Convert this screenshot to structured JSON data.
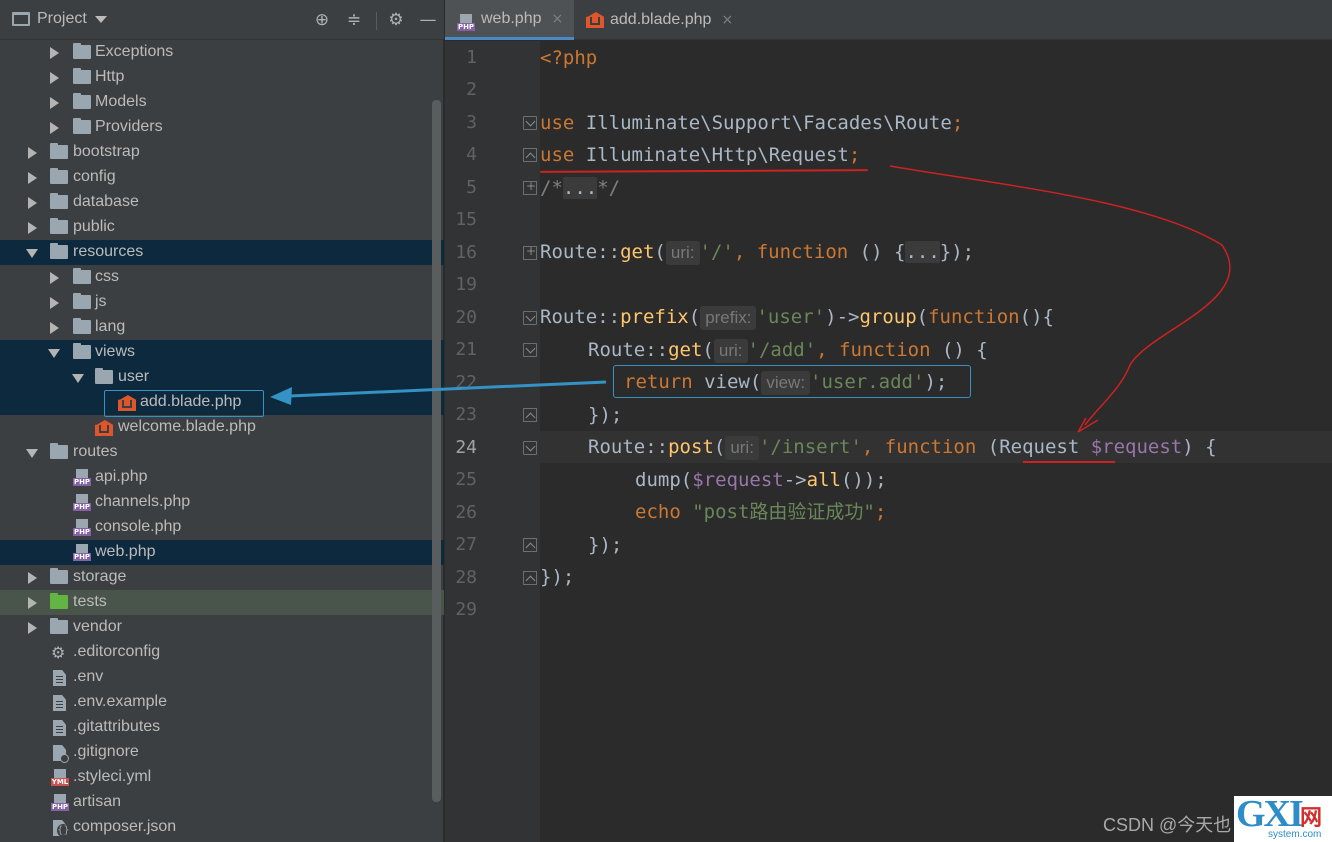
{
  "project_panel": {
    "title": "Project",
    "tree": [
      {
        "label": "Exceptions"
      },
      {
        "label": "Http"
      },
      {
        "label": "Models"
      },
      {
        "label": "Providers"
      },
      {
        "label": "bootstrap"
      },
      {
        "label": "config"
      },
      {
        "label": "database"
      },
      {
        "label": "public"
      },
      {
        "label": "resources"
      },
      {
        "label": "css"
      },
      {
        "label": "js"
      },
      {
        "label": "lang"
      },
      {
        "label": "views"
      },
      {
        "label": "user"
      },
      {
        "label": "add.blade.php"
      },
      {
        "label": "welcome.blade.php"
      },
      {
        "label": "routes"
      },
      {
        "label": "api.php"
      },
      {
        "label": "channels.php"
      },
      {
        "label": "console.php"
      },
      {
        "label": "web.php"
      },
      {
        "label": "storage"
      },
      {
        "label": "tests"
      },
      {
        "label": "vendor"
      },
      {
        "label": ".editorconfig"
      },
      {
        "label": ".env"
      },
      {
        "label": ".env.example"
      },
      {
        "label": ".gitattributes"
      },
      {
        "label": ".gitignore"
      },
      {
        "label": ".styleci.yml"
      },
      {
        "label": "artisan"
      },
      {
        "label": "composer.json"
      }
    ]
  },
  "tabs": [
    {
      "label": "web.php",
      "close": "×"
    },
    {
      "label": "add.blade.php",
      "close": "×"
    }
  ],
  "editor": {
    "line_numbers": [
      "1",
      "2",
      "3",
      "4",
      "5",
      "15",
      "16",
      "19",
      "20",
      "21",
      "22",
      "23",
      "24",
      "25",
      "26",
      "27",
      "28",
      "29"
    ],
    "current_line": "24"
  },
  "code": {
    "l1": "<?php",
    "l3_use": "use",
    "l3_rest": " Illuminate\\Support\\Facades\\Route",
    "semi": ";",
    "l4_use": "use",
    "l4_rest": " Illuminate\\Http\\Request",
    "l5_a": "/*",
    "l5_b": "...",
    "l5_c": "*/",
    "route": "Route",
    "dcolon": "::",
    "get": "get",
    "prefix": "prefix",
    "post": "post",
    "group": "group",
    "function": "function",
    "return": "return",
    "view": "view",
    "dump": "dump",
    "all": "all",
    "echo": "echo",
    "hint_uri": "uri:",
    "hint_prefix": "prefix:",
    "hint_view": "view:",
    "s_root": "'/'",
    "s_user": "'user'",
    "s_add": "'/add'",
    "s_user_add": "'user.add'",
    "s_insert": "'/insert'",
    "s_echo": "\"post路由验证成功\"",
    "request_type": "Request",
    "request_var": "$request",
    "folded_dots": "...",
    "l16_a": "(",
    "l16_b": ", ",
    "l16_c": " () {",
    "l16_d": "});",
    "l20_a": "(",
    "l20_b": ")->",
    "l20_c": "(",
    "l20_d": "(){",
    "l21_a": "(",
    "l21_b": ", ",
    "l21_c": " () {",
    "l22_a": "(",
    "l22_b": ");",
    "l23": "});",
    "l24_a": "(",
    "l24_b": ", ",
    "l24_c": " (",
    "l24_d": " ",
    "l24_e": ") {",
    "l25_a": "(",
    "l25_b": "->",
    "l25_c": "());",
    "l26_sp": " ",
    "l27": "});",
    "l28": "});"
  },
  "watermark": "CSDN @今天也",
  "logo": {
    "gx": "GXI",
    "wang": "网",
    "sys": "system.com"
  },
  "colors": {
    "keyword": "#cc7832",
    "function": "#ffc66d",
    "string": "#6a8759",
    "variable": "#9876aa",
    "annotation": "#3592c4",
    "markup_red": "#cc2222"
  }
}
